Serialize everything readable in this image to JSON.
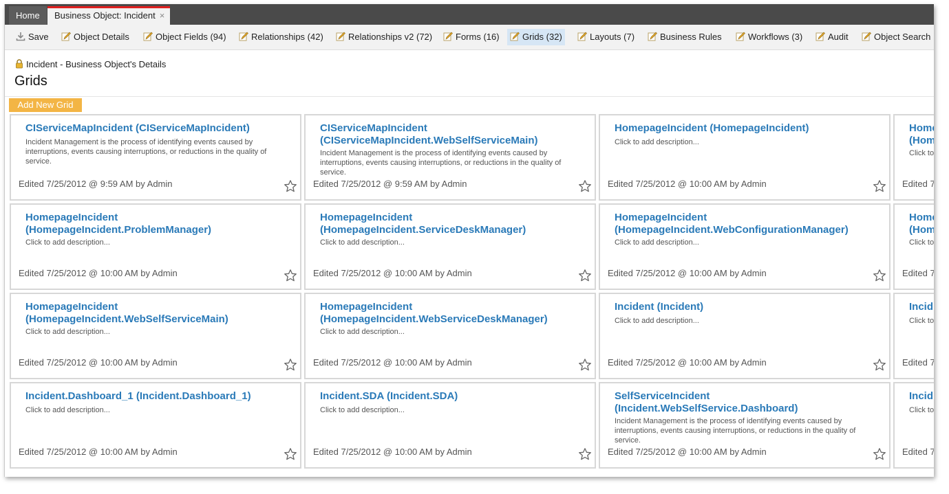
{
  "tabs": {
    "home": "Home",
    "active": "Business Object: Incident",
    "close": "×"
  },
  "toolbar": {
    "save": "Save",
    "object_details": "Object Details",
    "object_fields": "Object Fields (94)",
    "relationships": "Relationships (42)",
    "relationships_v2": "Relationships v2 (72)",
    "forms": "Forms (16)",
    "grids": "Grids (32)",
    "layouts": "Layouts (7)",
    "business_rules": "Business Rules",
    "workflows": "Workflows (3)",
    "audit": "Audit",
    "object_search": "Object Search"
  },
  "header": {
    "breadcrumb": "Incident - Business Object's Details",
    "title": "Grids",
    "add_button": "Add New Grid"
  },
  "colors": {
    "accent_button": "#f3b545",
    "link_blue": "#2a7ab8",
    "tab_red": "#e02020",
    "selected_tab": "#d6e6f5"
  },
  "cards": [
    {
      "t1": "CIServiceMapIncident (CIServiceMapIncident)",
      "t2": "",
      "desc": "Incident Management is the process of identifying events caused by interruptions, events causing interruptions, or reductions in the quality of service.",
      "edited": "Edited 7/25/2012 @ 9:59 AM by Admin"
    },
    {
      "t1": "CIServiceMapIncident",
      "t2": "(CIServiceMapIncident.WebSelfServiceMain)",
      "desc": "Incident Management is the process of identifying events caused by interruptions, events causing interruptions, or reductions in the quality of service.",
      "edited": "Edited 7/25/2012 @ 9:59 AM by Admin"
    },
    {
      "t1": "HomepageIncident (HomepageIncident)",
      "t2": "",
      "desc": "Click to add description...",
      "edited": "Edited 7/25/2012 @ 10:00 AM by Admin"
    },
    {
      "t1": "Home",
      "t2": "(Hom",
      "desc": "Click to",
      "edited": "Edited 7/"
    },
    {
      "t1": "HomepageIncident",
      "t2": "(HomepageIncident.ProblemManager)",
      "desc": "Click to add description...",
      "edited": "Edited 7/25/2012 @ 10:00 AM by Admin"
    },
    {
      "t1": "HomepageIncident",
      "t2": "(HomepageIncident.ServiceDeskManager)",
      "desc": "Click to add description...",
      "edited": "Edited 7/25/2012 @ 10:00 AM by Admin"
    },
    {
      "t1": "HomepageIncident",
      "t2": "(HomepageIncident.WebConfigurationManager)",
      "desc": "Click to add description...",
      "edited": "Edited 7/25/2012 @ 10:00 AM by Admin"
    },
    {
      "t1": "Home",
      "t2": "(Hom",
      "desc": "Click to",
      "edited": "Edited 7/"
    },
    {
      "t1": "HomepageIncident",
      "t2": "(HomepageIncident.WebSelfServiceMain)",
      "desc": "Click to add description...",
      "edited": "Edited 7/25/2012 @ 10:00 AM by Admin"
    },
    {
      "t1": "HomepageIncident",
      "t2": "(HomepageIncident.WebServiceDeskManager)",
      "desc": "Click to add description...",
      "edited": "Edited 7/25/2012 @ 10:00 AM by Admin"
    },
    {
      "t1": "Incident (Incident)",
      "t2": "",
      "desc": "Click to add description...",
      "edited": "Edited 7/25/2012 @ 10:00 AM by Admin"
    },
    {
      "t1": "Incid",
      "t2": "",
      "desc": "Click to",
      "edited": "Edited 7/"
    },
    {
      "t1": "Incident.Dashboard_1 (Incident.Dashboard_1)",
      "t2": "",
      "desc": "Click to add description...",
      "edited": "Edited 7/25/2012 @ 10:00 AM by Admin"
    },
    {
      "t1": "Incident.SDA (Incident.SDA)",
      "t2": "",
      "desc": "Click to add description...",
      "edited": "Edited 7/25/2012 @ 10:00 AM by Admin"
    },
    {
      "t1": "SelfServiceIncident",
      "t2": "(Incident.WebSelfService.Dashboard)",
      "desc": "Incident Management is the process of identifying events caused by interruptions, events causing interruptions, or reductions in the quality of service.",
      "edited": "Edited 7/25/2012 @ 10:00 AM by Admin"
    },
    {
      "t1": "Incid",
      "t2": "",
      "desc": "Click to",
      "edited": "Edited 7/"
    }
  ]
}
